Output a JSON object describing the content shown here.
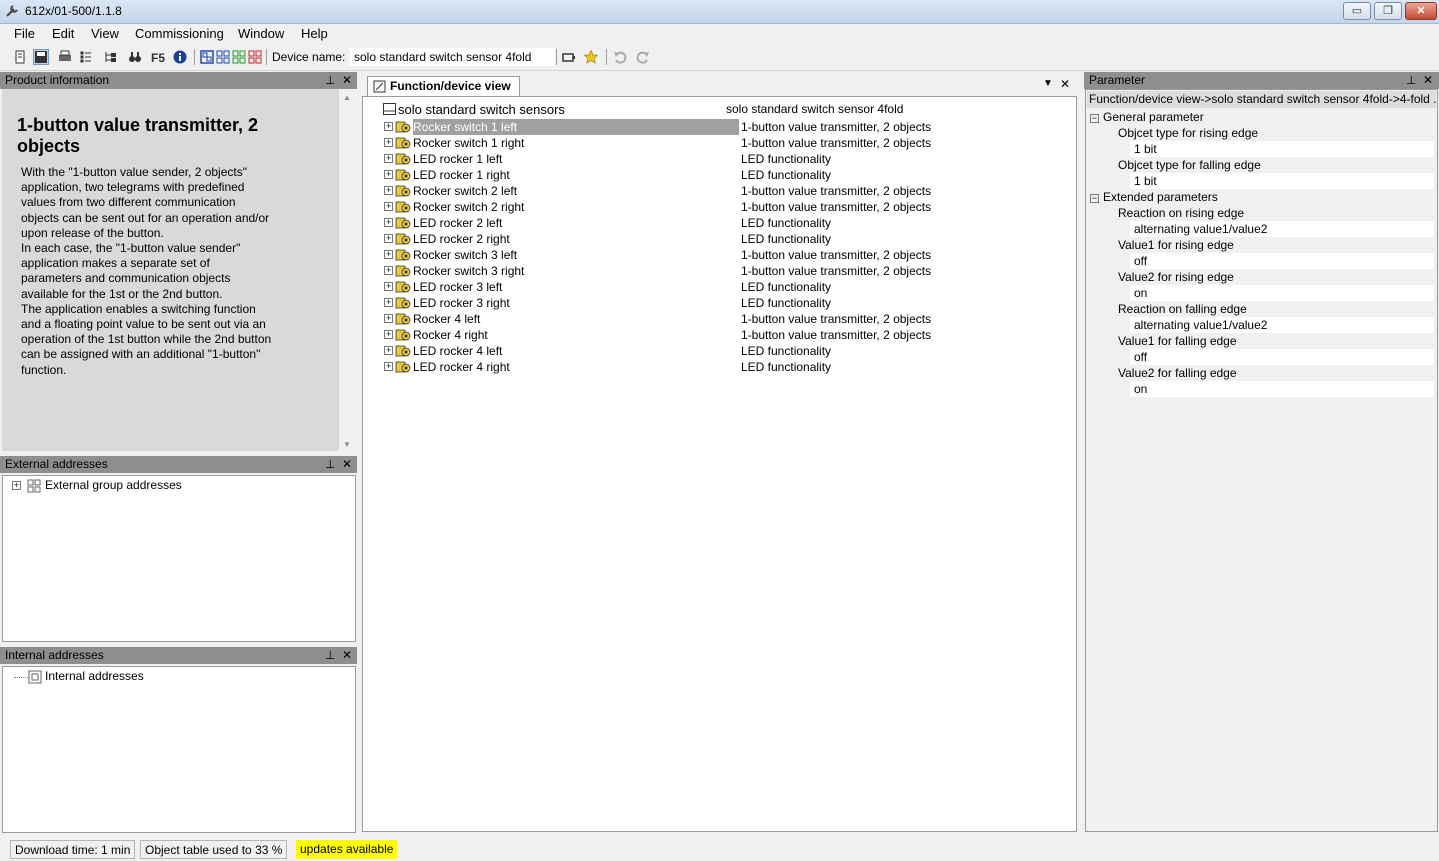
{
  "window": {
    "title": "612x/01-500/1.1.8",
    "controls": {
      "minimize": "▭",
      "maximize": "❐",
      "close": "✕"
    }
  },
  "menu": [
    "File",
    "Edit",
    "View",
    "Commissioning",
    "Window",
    "Help"
  ],
  "toolbar": {
    "device_name_label": "Device name:",
    "device_name_value": "solo standard switch sensor 4fold",
    "icons": [
      "new-icon",
      "save-icon",
      "print-icon",
      "list-icon",
      "tree-icon",
      "binoculars-icon",
      "f5-icon",
      "info-icon",
      "view1-icon",
      "view2-icon",
      "view3-icon",
      "view4-icon",
      "device-icon",
      "star-icon",
      "undo-icon",
      "redo-icon"
    ]
  },
  "product_info": {
    "header": "Product information",
    "title": "1-button value transmitter, 2 objects",
    "description": "With the \"1-button value sender, 2 objects\"\napplication, two telegrams with predefined\nvalues from two different communication\nobjects can be sent out for an operation and/or\nupon release of the button.\nIn each case, the \"1-button value sender\"\napplication makes a separate set of\nparameters and communication objects\navailable for the 1st or the 2nd button.\nThe application enables a switching function\nand a floating point value to be sent out via an\noperation of the 1st button while the 2nd button\ncan be assigned with an additional \"1-button\"\nfunction."
  },
  "external_addresses": {
    "header": "External addresses",
    "item": "External group addresses"
  },
  "internal_addresses": {
    "header": "Internal addresses",
    "item": "Internal addresses"
  },
  "center": {
    "tab": "Function/device view",
    "root_name": "solo standard switch sensors",
    "root_value": "solo standard switch sensor 4fold",
    "rows": [
      {
        "name": "Rocker switch 1 left",
        "value": "1-button value transmitter, 2 objects",
        "selected": true
      },
      {
        "name": "Rocker switch 1 right",
        "value": "1-button value transmitter, 2 objects"
      },
      {
        "name": "LED rocker 1 left",
        "value": "LED functionality"
      },
      {
        "name": "LED rocker 1 right",
        "value": "LED functionality"
      },
      {
        "name": "Rocker switch 2 left",
        "value": "1-button value transmitter, 2 objects"
      },
      {
        "name": "Rocker switch 2 right",
        "value": "1-button value transmitter, 2 objects"
      },
      {
        "name": "LED rocker 2 left",
        "value": "LED functionality"
      },
      {
        "name": "LED rocker 2 right",
        "value": "LED functionality"
      },
      {
        "name": "Rocker switch 3 left",
        "value": "1-button value transmitter, 2 objects"
      },
      {
        "name": "Rocker switch 3 right",
        "value": "1-button value transmitter, 2 objects"
      },
      {
        "name": "LED rocker 3 left",
        "value": "LED functionality"
      },
      {
        "name": "LED rocker 3 right",
        "value": "LED functionality"
      },
      {
        "name": "Rocker 4 left",
        "value": "1-button value transmitter, 2 objects"
      },
      {
        "name": "Rocker 4 right",
        "value": "1-button value transmitter, 2 objects"
      },
      {
        "name": "LED rocker 4 left",
        "value": "LED functionality"
      },
      {
        "name": "LED rocker 4 right",
        "value": "LED functionality"
      }
    ]
  },
  "parameter": {
    "header": "Parameter",
    "path": "Function/device view->solo standard switch sensor 4fold->4-fold ...",
    "groups": [
      {
        "label": "General parameter",
        "items": [
          {
            "label": "Objcet type for rising edge",
            "value": "1 bit"
          },
          {
            "label": "Objcet type for falling edge",
            "value": "1 bit"
          }
        ]
      },
      {
        "label": "Extended parameters",
        "items": [
          {
            "label": "Reaction on rising edge",
            "value": "alternating value1/value2"
          },
          {
            "label": "Value1 for rising edge",
            "value": "off"
          },
          {
            "label": "Value2 for rising edge",
            "value": "on"
          },
          {
            "label": "Reaction on falling edge",
            "value": "alternating value1/value2"
          },
          {
            "label": "Value1 for falling edge",
            "value": "off"
          },
          {
            "label": "Value2 for falling edge",
            "value": "on"
          }
        ]
      }
    ]
  },
  "status": {
    "download_time": "Download time: 1 min",
    "object_table": "Object table used to 33 %",
    "updates": "updates available"
  },
  "colors": {
    "panel_header": "#8e8e8e",
    "selection": "#a0a0a0",
    "updates_highlight": "#ffff00"
  }
}
